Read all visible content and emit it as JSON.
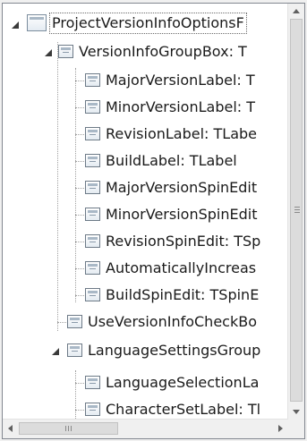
{
  "tree": {
    "root": {
      "label": "ProjectVersionInfoOptionsF",
      "expanded": true
    },
    "nodes": [
      {
        "label": "VersionInfoGroupBox: T",
        "expanded": true
      },
      {
        "label": "MajorVersionLabel: T"
      },
      {
        "label": "MinorVersionLabel: T"
      },
      {
        "label": "RevisionLabel: TLabe"
      },
      {
        "label": "BuildLabel: TLabel"
      },
      {
        "label": "MajorVersionSpinEdit"
      },
      {
        "label": "MinorVersionSpinEdit"
      },
      {
        "label": "RevisionSpinEdit: TSp"
      },
      {
        "label": "AutomaticallyIncreas"
      },
      {
        "label": "BuildSpinEdit: TSpinE"
      },
      {
        "label": "UseVersionInfoCheckBo"
      },
      {
        "label": "LanguageSettingsGroup",
        "expanded": true
      },
      {
        "label": "LanguageSelectionLa"
      },
      {
        "label": "CharacterSetLabel: Tl"
      }
    ]
  },
  "scrollbars": {
    "horizontal_grip": "III"
  }
}
